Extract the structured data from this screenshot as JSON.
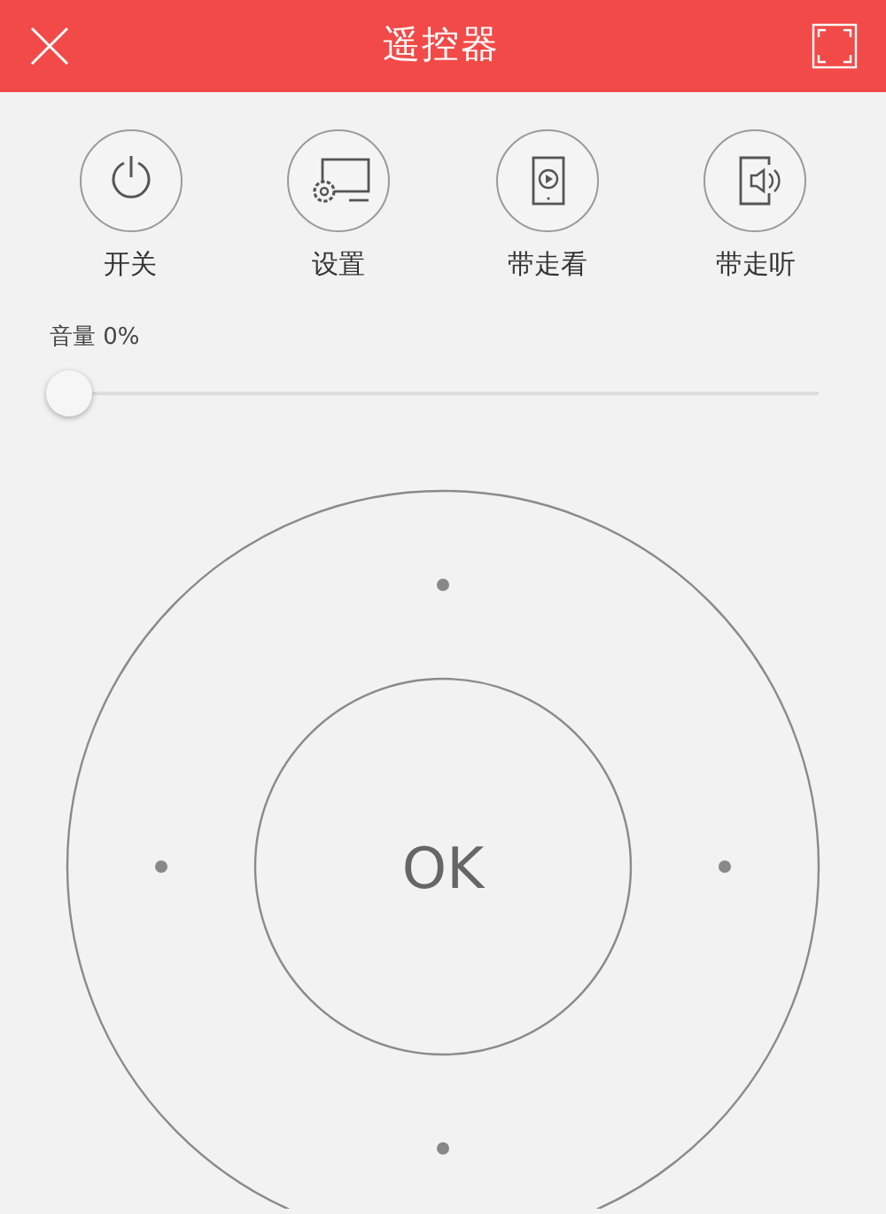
{
  "header": {
    "title": "遥控器"
  },
  "actions": [
    {
      "kind": "power",
      "label": "开关"
    },
    {
      "kind": "settings",
      "label": "设置"
    },
    {
      "kind": "watch",
      "label": "带走看"
    },
    {
      "kind": "listen",
      "label": "带走听"
    }
  ],
  "volume": {
    "label": "音量",
    "reading": "0%",
    "level": 0
  },
  "dpad": {
    "ok_label": "OK"
  }
}
